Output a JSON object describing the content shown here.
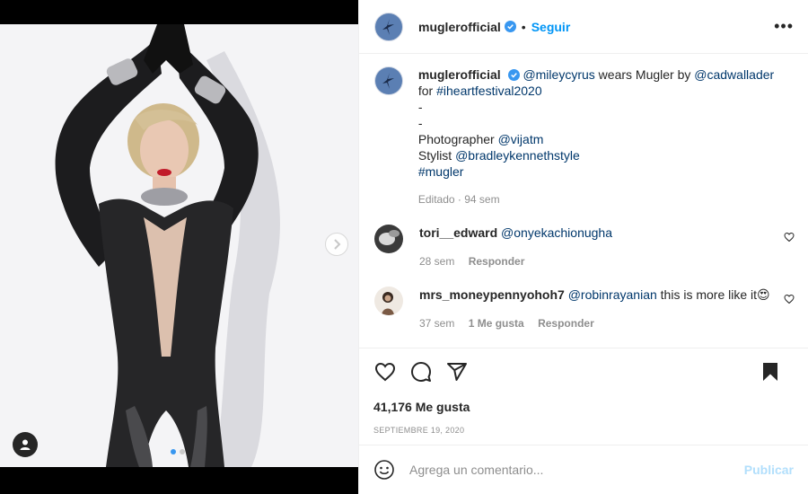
{
  "post": {
    "username": "muglerofficial",
    "separator": "•",
    "follow_label": "Seguir",
    "more_label": "•••"
  },
  "caption": {
    "username": "muglerofficial",
    "line1_mention": "@mileycyrus",
    "line1_text": " wears Mugler by ",
    "line1_mention2": "@cadwallader",
    "line2_text": "for ",
    "line2_hashtag": "#iheartfestival2020",
    "dash1": "-",
    "dash2": "-",
    "photographer_label": "Photographer ",
    "photographer": "@vijatm",
    "stylist_label": "Stylist ",
    "stylist": "@bradleykennethstyle",
    "hashtag": "#mugler",
    "meta": "Editado · 94 sem"
  },
  "comments": [
    {
      "username": "tori__edward",
      "mention": "@onyekachionugha",
      "text": "",
      "time": "28 sem",
      "likes": "",
      "reply_label": "Responder"
    },
    {
      "username": "mrs_moneypennyohoh7",
      "mention": "@robinrayanian",
      "text": " this is more like it😍",
      "time": "37 sem",
      "likes": "1 Me gusta",
      "reply_label": "Responder"
    }
  ],
  "stats": {
    "likes": "41,176 Me gusta",
    "date": "SEPTIEMBRE 19, 2020"
  },
  "compose": {
    "placeholder": "Agrega un comentario...",
    "publish_label": "Publicar"
  },
  "carousel": {
    "current_slide": 1,
    "total_slides": 2
  },
  "colors": {
    "accent": "#0095f6",
    "link": "#00376b",
    "muted": "#8e8e8e",
    "avatar_brand": "#5b7fb3"
  },
  "icons": {
    "next": "chevron-right-icon",
    "user_tag": "user-tag-icon",
    "verified": "verified-badge-icon",
    "like": "heart-icon",
    "comment": "comment-icon",
    "share": "share-icon",
    "save": "bookmark-icon",
    "emoji": "emoji-icon"
  }
}
